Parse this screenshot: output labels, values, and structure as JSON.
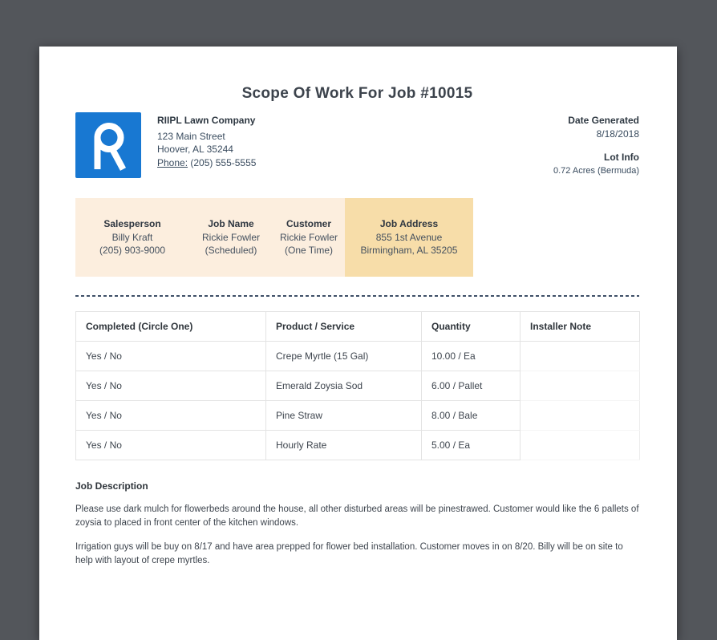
{
  "document": {
    "title": "Scope Of Work For Job #10015"
  },
  "company": {
    "name": "RIIPL Lawn Company",
    "address_line1": "123 Main Street",
    "address_line2": "Hoover, AL 35244",
    "phone_label": "Phone:",
    "phone_number": "(205) 555-5555",
    "logo_letter": "R",
    "logo_color": "#1878d2"
  },
  "meta": {
    "date_generated_label": "Date Generated",
    "date_generated_value": "8/18/2018",
    "lot_info_label": "Lot Info",
    "lot_info_value": "0.72 Acres (Bermuda)"
  },
  "job_info": {
    "bg_color": "#fceede",
    "highlight_color": "#f7dda9",
    "salesperson": {
      "label": "Salesperson",
      "line1": "Billy Kraft",
      "line2": "(205) 903-9000"
    },
    "job_name": {
      "label": "Job Name",
      "line1": "Rickie Fowler",
      "line2": "(Scheduled)"
    },
    "customer": {
      "label": "Customer",
      "line1": "Rickie Fowler",
      "line2": "(One Time)"
    },
    "job_address": {
      "label": "Job Address",
      "line1": "855 1st Avenue",
      "line2": "Birmingham, AL 35205"
    }
  },
  "work_table": {
    "headers": [
      "Completed (Circle One)",
      "Product / Service",
      "Quantity",
      "Installer Note"
    ],
    "rows": [
      [
        "Yes / No",
        "Crepe Myrtle (15 Gal)",
        "10.00 / Ea",
        ""
      ],
      [
        "Yes / No",
        "Emerald Zoysia Sod",
        "6.00 / Pallet",
        ""
      ],
      [
        "Yes / No",
        "Pine Straw",
        "8.00 / Bale",
        ""
      ],
      [
        "Yes / No",
        "Hourly Rate",
        "5.00 / Ea",
        ""
      ]
    ]
  },
  "job_description": {
    "heading": "Job Description",
    "paragraph1": "Please use dark mulch for flowerbeds around the house, all other disturbed areas will be pinestrawed. Customer would like the 6 pallets of zoysia to placed in front center of the kitchen windows.",
    "paragraph2": "Irrigation guys will be buy on 8/17 and have area prepped for flower bed installation. Customer moves in on 8/20. Billy will be on site to help with layout of crepe myrtles."
  },
  "colors": {
    "backdrop": "#53565b",
    "page": "#ffffff",
    "divider_navy": "#3f5068",
    "table_border": "#e3e3e3"
  }
}
